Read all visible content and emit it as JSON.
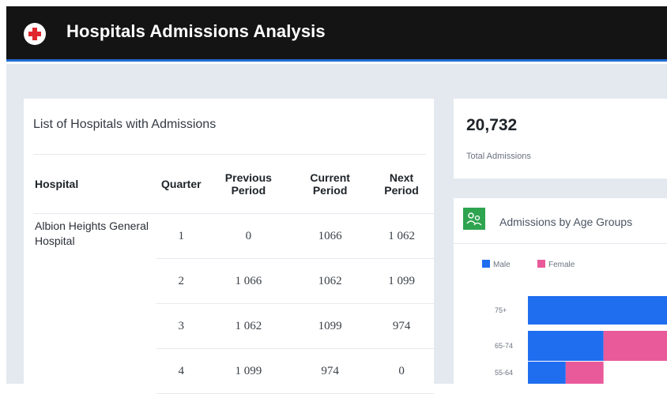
{
  "header": {
    "title": "Hospitals Admissions Analysis",
    "logo_icon": "red-cross-icon",
    "accent_color": "#1f6ed4"
  },
  "table_card": {
    "title": "List of Hospitals with Admissions",
    "columns": [
      "Hospital",
      "Quarter",
      "Previous Period",
      "Current Period",
      "Next Period"
    ],
    "hospital_name": "Albion Heights General Hospital",
    "rows": [
      {
        "quarter": "1",
        "previous": "0",
        "current": "1066",
        "next": "1 062"
      },
      {
        "quarter": "2",
        "previous": "1 066",
        "current": "1062",
        "next": "1 099"
      },
      {
        "quarter": "3",
        "previous": "1 062",
        "current": "1099",
        "next": "974"
      },
      {
        "quarter": "4",
        "previous": "1 099",
        "current": "974",
        "next": "0"
      }
    ]
  },
  "total_card": {
    "value": "20,732",
    "label": "Total Admissions"
  },
  "chart_card": {
    "title": "Admissions by Age Groups",
    "icon": "people-icon"
  },
  "chart_data": {
    "type": "bar",
    "orientation": "horizontal",
    "stacked": true,
    "categories": [
      "75+",
      "65-74",
      "55-64"
    ],
    "series": [
      {
        "name": "Male",
        "color": "#1f6ef0",
        "values": [
          1.0,
          0.52,
          0.26
        ]
      },
      {
        "name": "Female",
        "color": "#e85a9a",
        "values": [
          0.0,
          0.48,
          0.26
        ]
      }
    ],
    "legend_position": "top-left",
    "note_scale": "values are approximate relative shares of the visible portion"
  }
}
